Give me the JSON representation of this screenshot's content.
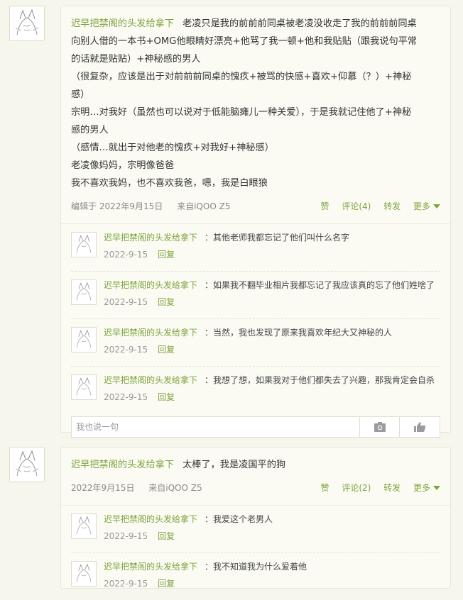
{
  "posts": [
    {
      "author": "迟早把禁阁的头发给拿下",
      "lines": [
        "老凌只是我的前前前同桌被老凌没收走了我的前前前同桌",
        "向别人借的一本书+OMG他眼睛好漂亮+他骂了我一顿+他和我贴贴（跟我说句平常",
        "的话就是贴贴）+神秘感的男人",
        "（很复杂，应该是出于对前前前同桌的愧疚+被骂的快感+喜欢+仰慕（？）+神秘",
        "感）",
        "宗明…对我好（虽然也可以说对于低能脑瘫儿一种关爱），于是我就记住他了+神秘",
        "感的男人",
        "（感情…就出于对他老的愧疚+对我好+神秘感）",
        "老凌像妈妈，宗明像爸爸",
        "我不喜欢我妈，也不喜欢我爸，嗯，我是白眼狼"
      ],
      "time": "编辑于 2022年9月15日",
      "source": "来自iQOO Z5",
      "actions": {
        "like": "赞",
        "comment": "评论(4)",
        "repost": "转发",
        "more": "更多"
      },
      "comments": [
        {
          "author": "迟早把禁阁的头发给拿下",
          "text": "：其他老师我都忘记了他们叫什么名字",
          "date": "2022-9-15",
          "reply": "回复"
        },
        {
          "author": "迟早把禁阁的头发给拿下",
          "text": "：如果我不翻毕业相片我都忘记了我应该真的忘了他们姓啥了",
          "date": "2022-9-15",
          "reply": "回复"
        },
        {
          "author": "迟早把禁阁的头发给拿下",
          "text": "：当然，我也发现了原来我喜欢年纪大又神秘的人",
          "date": "2022-9-15",
          "reply": "回复"
        },
        {
          "author": "迟早把禁阁的头发给拿下",
          "text": "：我想了想，如果我对于他们都失去了兴趣，那我肯定会自杀",
          "date": "2022-9-15",
          "reply": "回复"
        }
      ],
      "input_placeholder": "我也说一句"
    },
    {
      "author": "迟早把禁阁的头发给拿下",
      "lines": [
        "太棒了，我是凌国平的狗"
      ],
      "time": "2022年9月15日",
      "source": "来自iQOO Z5",
      "actions": {
        "like": "赞",
        "comment": "评论(2)",
        "repost": "转发",
        "more": "更多"
      },
      "comments": [
        {
          "author": "迟早把禁阁的头发给拿下",
          "text": "：我爱这个老男人",
          "date": "2022-9-15",
          "reply": "回复"
        },
        {
          "author": "迟早把禁阁的头发给拿下",
          "text": "：我不知道我为什么爱着他",
          "date": "2022-9-15",
          "reply": "回复"
        }
      ]
    }
  ],
  "icons": {
    "avatar": "avatar-sketch-icon",
    "camera": "camera-icon",
    "thumb": "thumb-icon"
  },
  "colors": {
    "accent": "#7ea33c",
    "background": "#f6f6ec"
  }
}
